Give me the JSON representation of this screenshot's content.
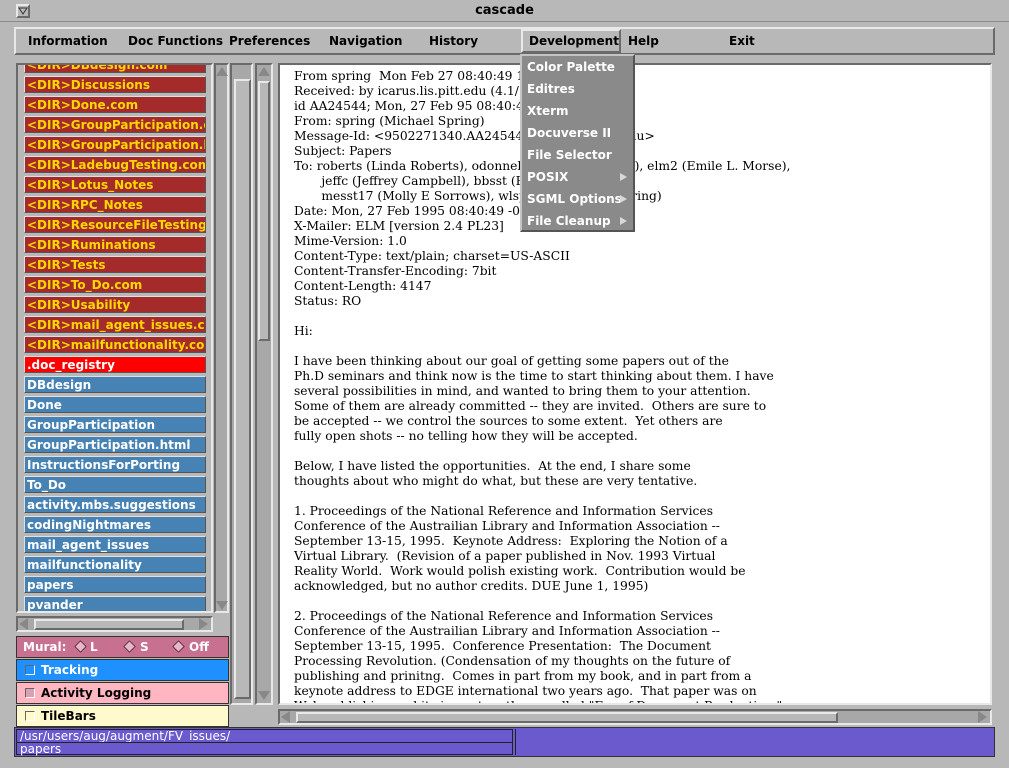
{
  "window": {
    "title": "cascade"
  },
  "menubar": [
    {
      "id": "information",
      "label": "Information"
    },
    {
      "id": "doc-functions",
      "label": "Doc Functions"
    },
    {
      "id": "preferences",
      "label": "Preferences"
    },
    {
      "id": "navigation",
      "label": "Navigation"
    },
    {
      "id": "history",
      "label": "History"
    },
    {
      "id": "development",
      "label": "Development"
    },
    {
      "id": "help",
      "label": "Help"
    },
    {
      "id": "exit",
      "label": "Exit"
    }
  ],
  "dropdown": [
    {
      "label": "Color Palette",
      "submenu": false
    },
    {
      "label": "Editres",
      "submenu": false
    },
    {
      "label": "Xterm",
      "submenu": false
    },
    {
      "label": "Docuverse II",
      "submenu": false
    },
    {
      "label": "File Selector",
      "submenu": false
    },
    {
      "label": "POSIX",
      "submenu": true
    },
    {
      "label": "SGML Options",
      "submenu": true
    },
    {
      "label": "File Cleanup",
      "submenu": true
    }
  ],
  "files": [
    {
      "label": "<DIR>DBdesign.com",
      "kind": "dir"
    },
    {
      "label": "<DIR>Discussions",
      "kind": "dir"
    },
    {
      "label": "<DIR>Done.com",
      "kind": "dir"
    },
    {
      "label": "<DIR>GroupParticipation.com",
      "kind": "dir"
    },
    {
      "label": "<DIR>GroupParticipation.html.com",
      "kind": "dir"
    },
    {
      "label": "<DIR>LadebugTesting.com",
      "kind": "dir"
    },
    {
      "label": "<DIR>Lotus_Notes",
      "kind": "dir"
    },
    {
      "label": "<DIR>RPC_Notes",
      "kind": "dir"
    },
    {
      "label": "<DIR>ResourceFileTesting.com",
      "kind": "dir"
    },
    {
      "label": "<DIR>Ruminations",
      "kind": "dir"
    },
    {
      "label": "<DIR>Tests",
      "kind": "dir"
    },
    {
      "label": "<DIR>To_Do.com",
      "kind": "dir"
    },
    {
      "label": "<DIR>Usability",
      "kind": "dir"
    },
    {
      "label": "<DIR>mail_agent_issues.com",
      "kind": "dir"
    },
    {
      "label": "<DIR>mailfunctionality.com",
      "kind": "dir"
    },
    {
      "label": ".doc_registry",
      "kind": "sel"
    },
    {
      "label": "DBdesign",
      "kind": "file"
    },
    {
      "label": "Done",
      "kind": "file"
    },
    {
      "label": "GroupParticipation",
      "kind": "file"
    },
    {
      "label": "GroupParticipation.html",
      "kind": "file"
    },
    {
      "label": "InstructionsForPorting",
      "kind": "file"
    },
    {
      "label": "To_Do",
      "kind": "file"
    },
    {
      "label": "activity.mbs.suggestions",
      "kind": "file"
    },
    {
      "label": "codingNightmares",
      "kind": "file"
    },
    {
      "label": "mail_agent_issues",
      "kind": "file"
    },
    {
      "label": "mailfunctionality",
      "kind": "file"
    },
    {
      "label": "papers",
      "kind": "file"
    },
    {
      "label": "pvander",
      "kind": "file"
    }
  ],
  "mural": {
    "label": "Mural:",
    "options": [
      "L",
      "S",
      "Off"
    ]
  },
  "toggles": {
    "tracking": "Tracking",
    "logging": "Activity Logging",
    "tilebars": "TileBars"
  },
  "document": {
    "text": "From spring  Mon Feb 27 08:40:49 1995\nReceived: by icarus.lis.pitt.edu (4.1/1.34)\nid AA24544; Mon, 27 Feb 95 08:40:49 EST\nFrom: spring (Michael Spring)\nMessage-Id: <9502271340.AA24544@icarus.lis.pitt.edu>\nSubject: Papers\nTo: roberts (Linda Roberts), odonnell (Kevin O'Donnell), elm2 (Emile L. Morse),\n       jeffc (Jeffrey Campbell), bbsst (Beth Smith),\n       messt17 (Molly E Sorrows), wlspring (Michael Spring)\nDate: Mon, 27 Feb 1995 08:40:49 -0500 (EST)\nX-Mailer: ELM [version 2.4 PL23]\nMime-Version: 1.0\nContent-Type: text/plain; charset=US-ASCII\nContent-Transfer-Encoding: 7bit\nContent-Length: 4147\nStatus: RO\n\nHi:\n\nI have been thinking about our goal of getting some papers out of the\nPh.D seminars and think now is the time to start thinking about them. I have\nseveral possibilities in mind, and wanted to bring them to your attention.\nSome of them are already committed -- they are invited.  Others are sure to\nbe accepted -- we control the sources to some extent.  Yet others are\nfully open shots -- no telling how they will be accepted.\n\nBelow, I have listed the opportunities.  At the end, I share some\nthoughts about who might do what, but these are very tentative.\n\n1. Proceedings of the National Reference and Information Services\nConference of the Austrailian Library and Information Association --\nSeptember 13-15, 1995.  Keynote Address:  Exploring the Notion of a\nVirtual Library.  (Revision of a paper published in Nov. 1993 Virtual\nReality World.  Work would polish existing work.  Contribution would be\nacknowledged, but no author credits. DUE June 1, 1995)\n\n2. Proceedings of the National Reference and Information Services\nConference of the Austrailian Library and Information Association --\nSeptember 13-15, 1995.  Conference Presentation:  The Document\nProcessing Revolution. (Condensation of my thoughts on the future of\npublishing and prinitng.  Comes in part from my book, and in part from a\nkeynote address to EDGE international two years ago.  That paper was on\nWeb publishing and its impact on the so called \"Era of Document Production.\""
  },
  "status": {
    "path_line1": "/usr/users/aug/augment/FV_issues/",
    "path_line2": "papers"
  }
}
